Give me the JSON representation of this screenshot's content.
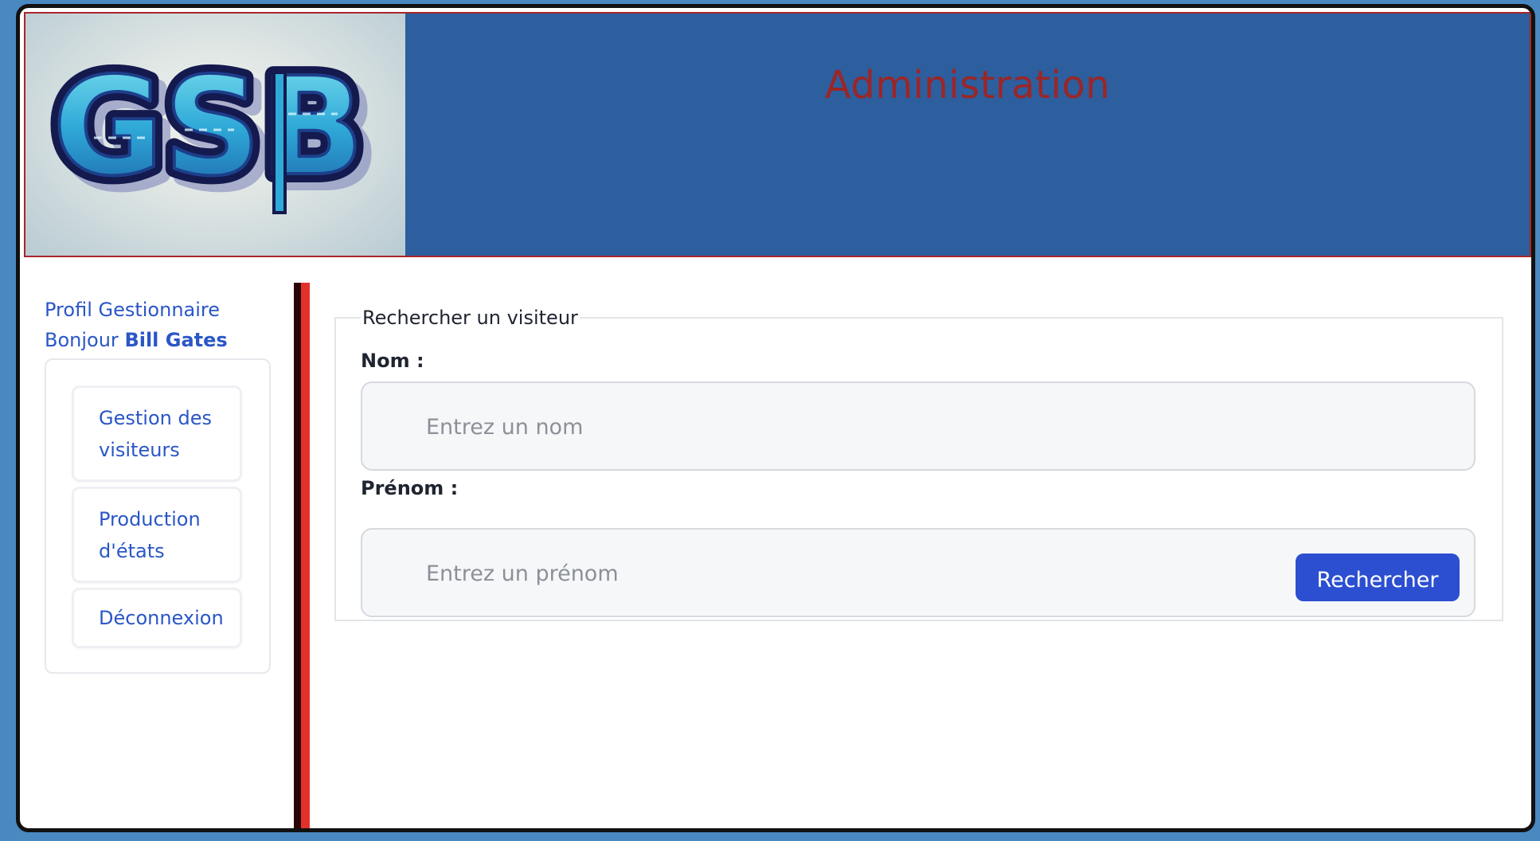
{
  "header": {
    "logo_text": "GSB",
    "title": "Administration"
  },
  "sidebar": {
    "profile": "Profil Gestionnaire",
    "greeting": "Bonjour",
    "user_name": "Bill Gates",
    "items": [
      {
        "label_line1": "Gestion des",
        "label_line2": "visiteurs"
      },
      {
        "label_line1": "Production",
        "label_line2": "d'états"
      },
      {
        "label": "Déconnexion"
      }
    ]
  },
  "search": {
    "legend": "Rechercher un visiteur",
    "nom_label": "Nom :",
    "nom_placeholder": "Entrez un nom",
    "nom_value": "",
    "prenom_label": "Prénom :",
    "prenom_placeholder": "Entrez un prénom",
    "prenom_value": "",
    "button_label": "Rechercher"
  },
  "colors": {
    "header_bg": "#2d5e9e",
    "title": "#9b2626",
    "link": "#2a56c6",
    "button": "#2b4fd0",
    "divider_dark": "#2a0505",
    "divider_red": "#e2312a",
    "page_bg": "#4a88c2"
  }
}
